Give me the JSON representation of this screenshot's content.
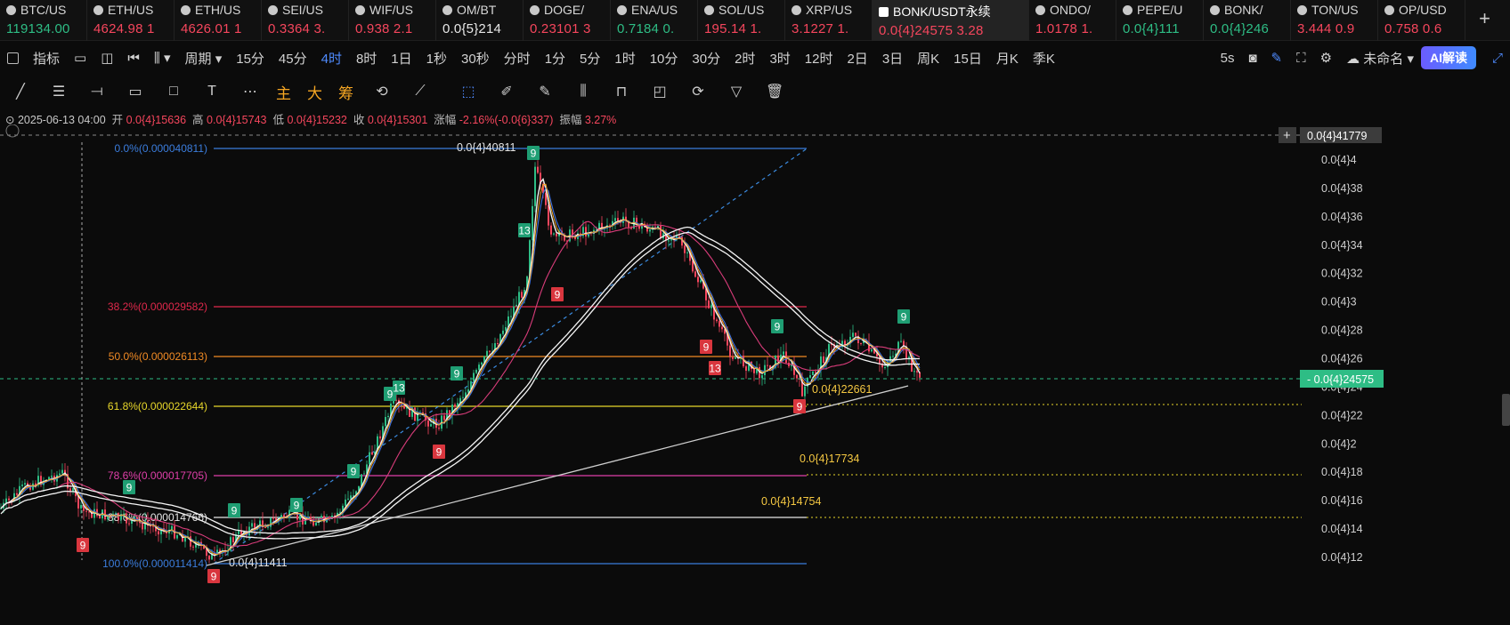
{
  "tickers": [
    {
      "symbol": "BTC/US",
      "price": "119134.00",
      "change": "",
      "dir": "up"
    },
    {
      "symbol": "ETH/US",
      "price": "4624.98",
      "change": "1",
      "dir": "dn"
    },
    {
      "symbol": "ETH/US",
      "price": "4626.01",
      "change": "1",
      "dir": "dn"
    },
    {
      "symbol": "SEI/US",
      "price": "0.3364",
      "change": "3.",
      "dir": "dn"
    },
    {
      "symbol": "WIF/US",
      "price": "0.938",
      "change": "2.1",
      "dir": "dn"
    },
    {
      "symbol": "OM/BT",
      "price": "0.0{5}214",
      "change": "",
      "dir": "wh"
    },
    {
      "symbol": "DOGE/",
      "price": "0.23101",
      "change": "3",
      "dir": "dn"
    },
    {
      "symbol": "ENA/US",
      "price": "0.7184",
      "change": "0.",
      "dir": "up"
    },
    {
      "symbol": "SOL/US",
      "price": "195.14",
      "change": "1.",
      "dir": "dn"
    },
    {
      "symbol": "XRP/US",
      "price": "3.1227",
      "change": "1.",
      "dir": "dn"
    },
    {
      "symbol": "BONK/USDT永续",
      "price": "0.0{4}24575",
      "change": "3.28",
      "dir": "dn",
      "active": true
    },
    {
      "symbol": "ONDO/",
      "price": "1.0178",
      "change": "1.",
      "dir": "dn"
    },
    {
      "symbol": "PEPE/U",
      "price": "0.0{4}111",
      "change": "",
      "dir": "up"
    },
    {
      "symbol": "BONK/",
      "price": "0.0{4}246",
      "change": "",
      "dir": "up"
    },
    {
      "symbol": "TON/US",
      "price": "3.444",
      "change": "0.9",
      "dir": "dn"
    },
    {
      "symbol": "OP/USD",
      "price": "0.758",
      "change": "0.6",
      "dir": "dn"
    }
  ],
  "toolbar": {
    "indicators": "指标",
    "period": "周期",
    "intervals": [
      "15分",
      "45分",
      "4时",
      "8时",
      "1日",
      "1秒",
      "30秒",
      "分时",
      "1分",
      "5分",
      "1时",
      "10分",
      "30分",
      "2时",
      "3时",
      "12时",
      "2日",
      "3日",
      "周K",
      "15日",
      "月K",
      "季K"
    ],
    "selected_interval": "4时",
    "refresh": "5s",
    "layout_name": "未命名",
    "ai_button": "AI解读"
  },
  "drawtools": {
    "main": "主",
    "big": "大",
    "chip": "筹"
  },
  "info": {
    "date": "2025-06-13 04:00",
    "open_label": "开",
    "open": "0.0{4}15636",
    "high_label": "高",
    "high": "0.0{4}15743",
    "low_label": "低",
    "low": "0.0{4}15232",
    "close_label": "收",
    "close": "0.0{4}15301",
    "chg_label": "涨幅",
    "chg": "-2.16%(-0.0{6}337)",
    "amp_label": "振幅",
    "amp": "3.27%"
  },
  "price_axis": {
    "labels": [
      "0.0{4}4",
      "0.0{4}38",
      "0.0{4}36",
      "0.0{4}34",
      "0.0{4}32",
      "0.0{4}3",
      "0.0{4}28",
      "0.0{4}26",
      "0.0{4}24",
      "0.0{4}22",
      "0.0{4}2",
      "0.0{4}18",
      "0.0{4}16",
      "0.0{4}14",
      "0.0{4}12"
    ],
    "crosshair_price": "0.0{4}41779",
    "last_price": "0.0{4}24575"
  },
  "fib_levels": [
    {
      "label": "0.0%(0.000040811)",
      "color": "#3b7ddd"
    },
    {
      "label": "38.2%(0.000029582)",
      "color": "#e0284b"
    },
    {
      "label": "50.0%(0.000026113)",
      "color": "#f08a24"
    },
    {
      "label": "61.8%(0.000022644)",
      "color": "#e7d62a"
    },
    {
      "label": "78.6%(0.000017705)",
      "color": "#e03fa9"
    },
    {
      "label": "88.6%(0.000014766)",
      "color": "#e6e6e6"
    },
    {
      "label": "100.0%(0.000011414)",
      "color": "#3b7ddd"
    }
  ],
  "annotations": {
    "high_price": "0.0{4}40811",
    "low_price": "0.0{4}11411",
    "support_1": "0.0{4}22661",
    "support_2": "0.0{4}17734",
    "support_3": "0.0{4}14754"
  },
  "td_markers": [
    "9",
    "9",
    "9",
    "9",
    "9",
    "9",
    "9",
    "13",
    "9",
    "9",
    "13",
    "9",
    "9",
    "9",
    "13",
    "9",
    "9",
    "9",
    "9"
  ],
  "colors": {
    "up": "#2ebd85",
    "down": "#f6465d",
    "accent": "#4f8bff"
  }
}
